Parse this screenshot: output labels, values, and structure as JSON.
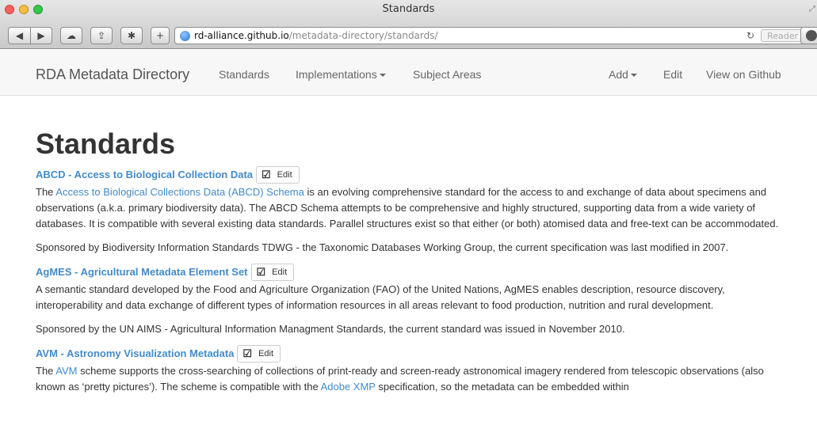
{
  "window": {
    "title": "Standards"
  },
  "browser": {
    "url_host": "rd-alliance.github.io",
    "url_path": "/metadata-directory/standards/",
    "reader_label": "Reader",
    "reload_icon": "reload-icon"
  },
  "navbar": {
    "brand": "RDA Metadata Directory",
    "items": [
      {
        "label": "Standards"
      },
      {
        "label": "Implementations"
      },
      {
        "label": "Subject Areas"
      },
      {
        "label": "Add"
      },
      {
        "label": "Edit"
      },
      {
        "label": "View on Github"
      }
    ]
  },
  "page": {
    "title": "Standards",
    "edit_label": "Edit"
  },
  "standards": [
    {
      "title": "ABCD - Access to Biological Collection Data",
      "desc_prefix": "The ",
      "desc_link": "Access to Biological Collections Data (ABCD) Schema",
      "desc_rest": " is an evolving comprehensive standard for the access to and exchange of data about specimens and observations (a.k.a. primary biodiversity data). The ABCD Schema attempts to be comprehensive and highly structured, supporting data from a wide variety of databases. It is compatible with several existing data standards. Parallel structures exist so that either (or both) atomised data and free-text can be accommodated.",
      "sponsor": "Sponsored by Biodiversity Information Standards TDWG - the Taxonomic Databases Working Group, the current specification was last modified in 2007."
    },
    {
      "title": "AgMES - Agricultural Metadata Element Set",
      "desc": "A semantic standard developed by the Food and Agriculture Organization (FAO) of the United Nations, AgMES enables description, resource discovery, interoperability and data exchange of different types of information resources in all areas relevant to food production, nutrition and rural development.",
      "sponsor": "Sponsored by the UN AIMS - Agricultural Information Managment Standards, the current standard was issued in November 2010."
    },
    {
      "title": "AVM - Astronomy Visualization Metadata",
      "desc_prefix": "The ",
      "desc_link": "AVM",
      "desc_mid": " scheme supports the cross-searching of collections of print-ready and screen-ready astronomical imagery rendered from telescopic observations (also known as ‘pretty pictures’). The scheme is compatible with the ",
      "desc_link2": "Adobe XMP",
      "desc_end": " specification, so the metadata can be embedded within"
    }
  ]
}
